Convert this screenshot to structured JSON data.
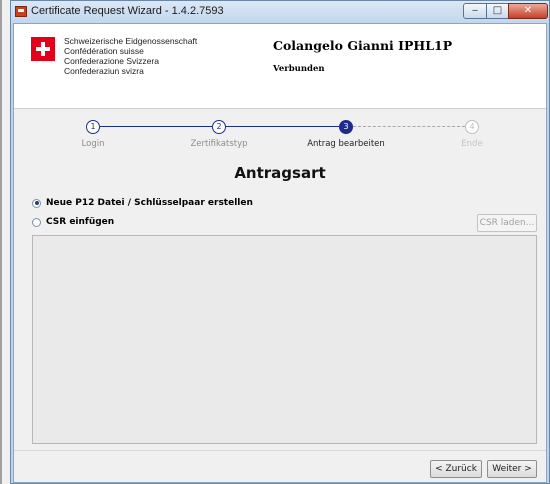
{
  "window": {
    "title": "Certificate Request Wizard - 1.4.2.7593",
    "controls": {
      "minimize": "‒",
      "maximize": "□",
      "close": "✕"
    }
  },
  "header": {
    "org_lines": [
      "Schweizerische Eidgenossenschaft",
      "Confédération suisse",
      "Confederazione Svizzera",
      "Confederaziun svizra"
    ],
    "user_name": "Colangelo Gianni IPHL1P",
    "status": "Verbunden"
  },
  "wizard": {
    "steps": [
      {
        "number": "1",
        "label": "Login",
        "state": "done"
      },
      {
        "number": "2",
        "label": "Zertifikatstyp",
        "state": "done"
      },
      {
        "number": "3",
        "label": "Antrag bearbeiten",
        "state": "active"
      },
      {
        "number": "4",
        "label": "Ende",
        "state": "pending"
      }
    ]
  },
  "main": {
    "title": "Antragsart",
    "options": [
      {
        "label": "Neue P12 Datei / Schlüsselpaar erstellen",
        "checked": true
      },
      {
        "label": "CSR einfügen",
        "checked": false
      }
    ],
    "load_csr_label": "CSR laden...",
    "csr_text": ""
  },
  "footer": {
    "back_label": "< Zurück",
    "next_label": "Weiter >"
  },
  "colors": {
    "step_accent": "#1e2d8c",
    "flag_red": "#e3001b"
  }
}
